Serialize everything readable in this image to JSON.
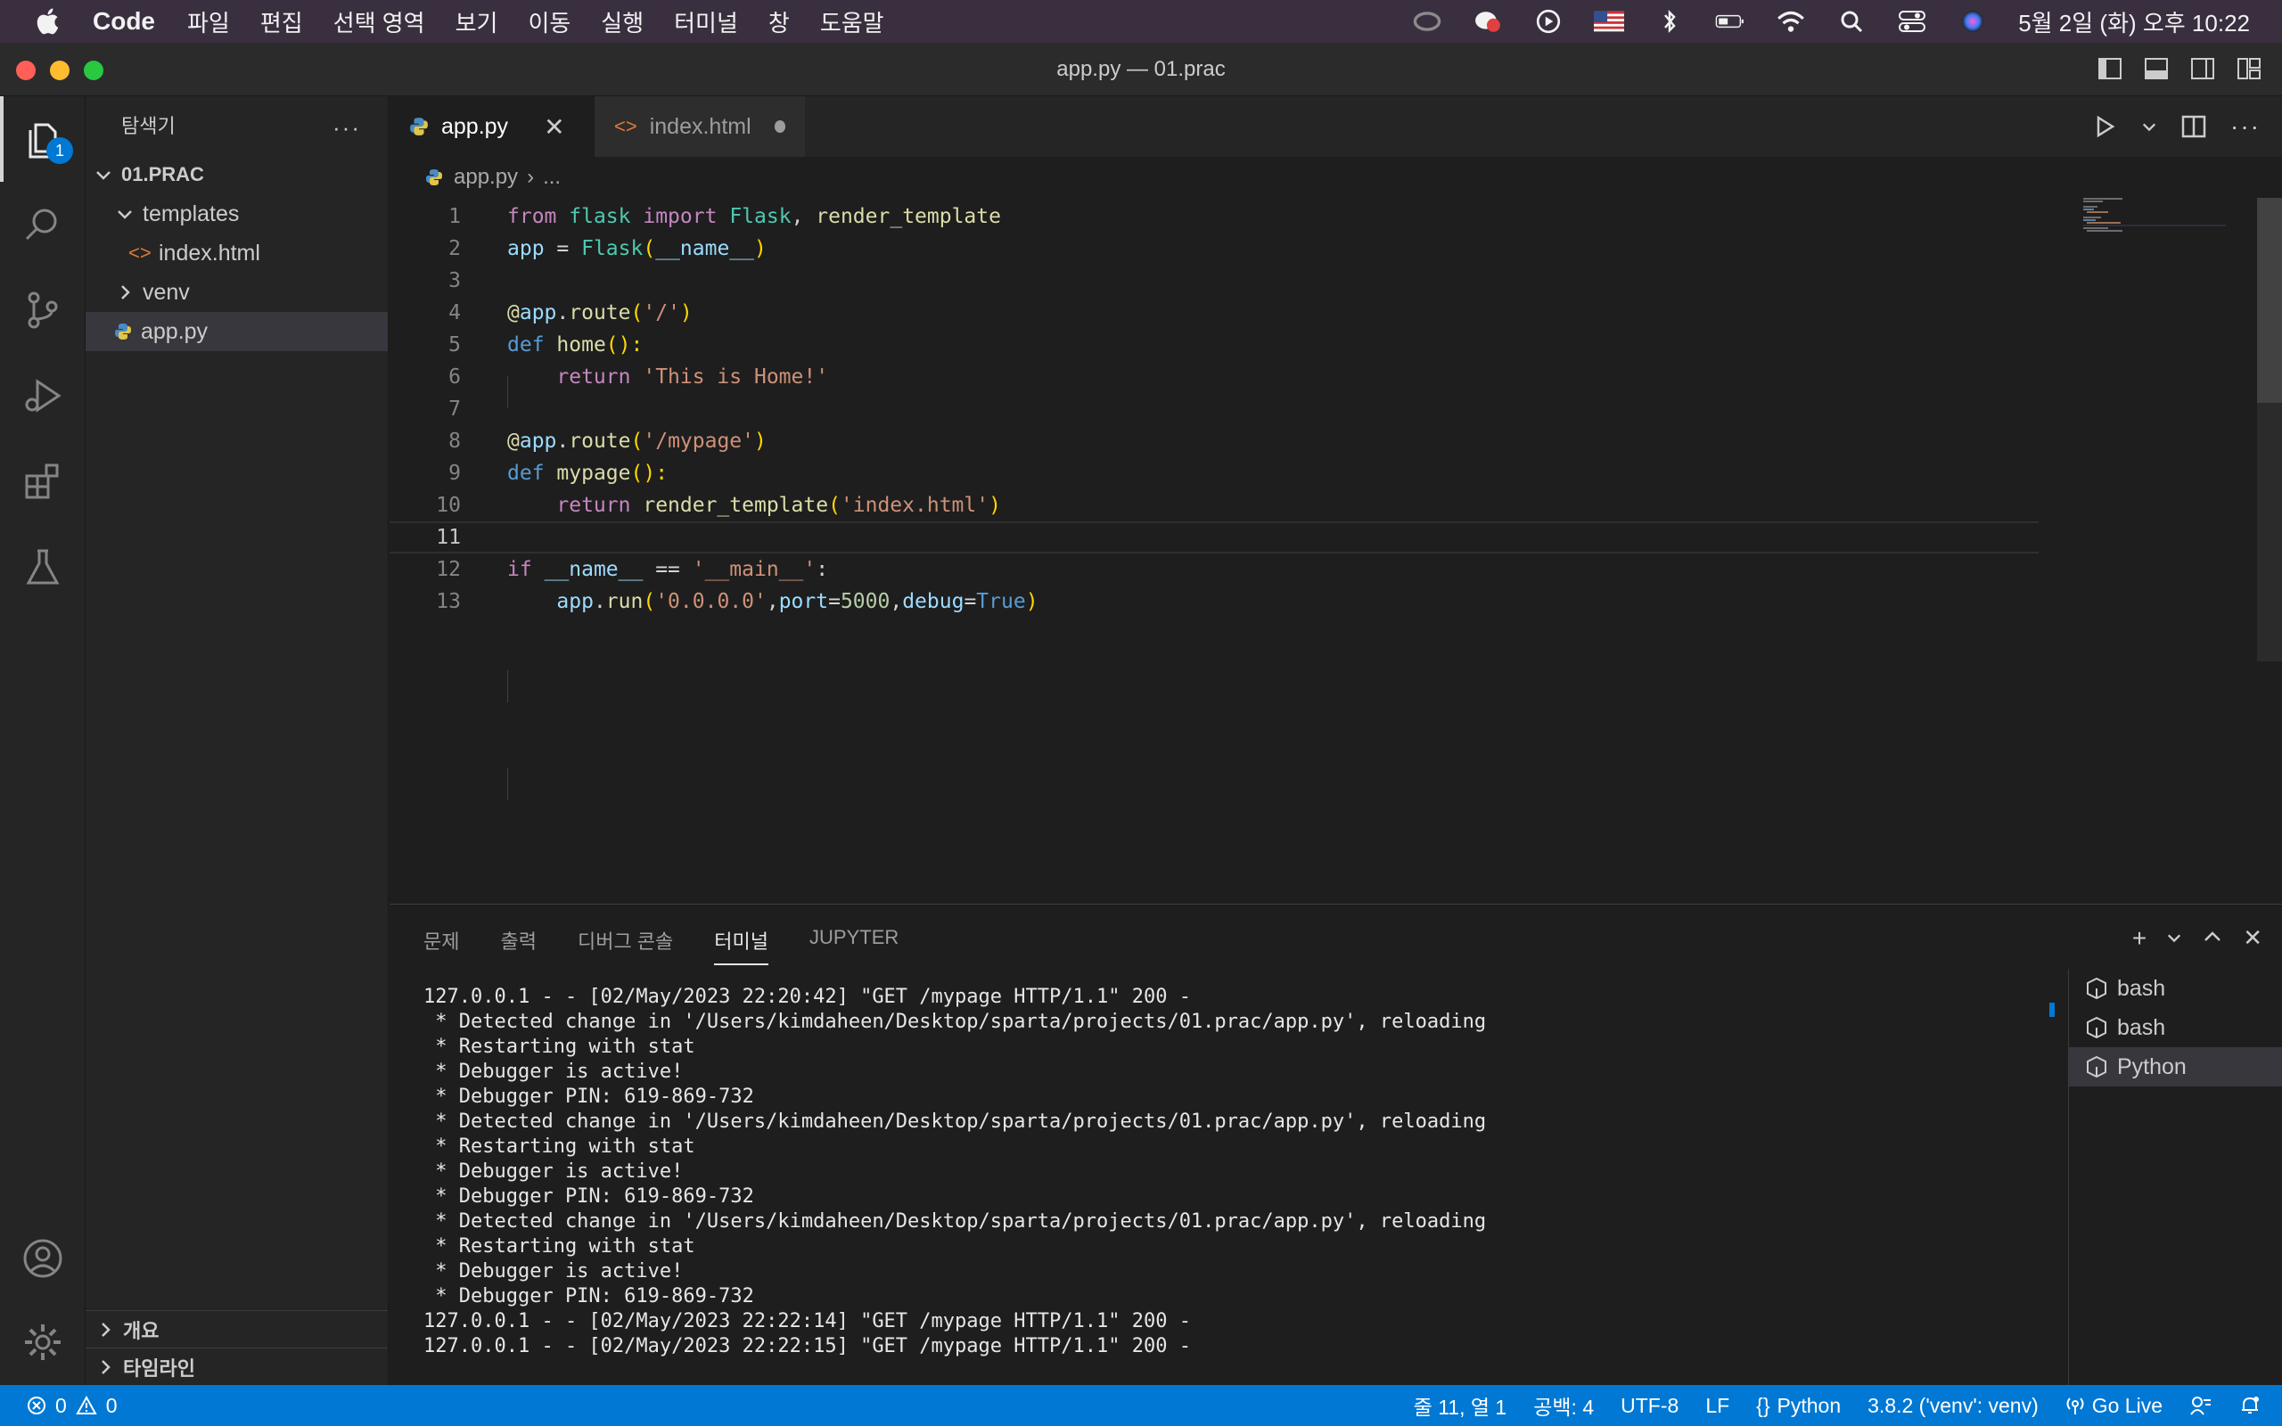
{
  "menubar": {
    "app_name": "Code",
    "items": [
      "파일",
      "편집",
      "선택 영역",
      "보기",
      "이동",
      "실행",
      "터미널",
      "창",
      "도움말"
    ],
    "clock": "5월 2일 (화) 오후 10:22"
  },
  "window": {
    "title": "app.py — 01.prac"
  },
  "activity": {
    "explorer_badge": "1"
  },
  "sidebar": {
    "title": "탐색기",
    "more": "···",
    "root": "01.PRAC",
    "items": [
      {
        "label": "templates"
      },
      {
        "label": "index.html"
      },
      {
        "label": "venv"
      },
      {
        "label": "app.py"
      }
    ],
    "outline": "개요",
    "timeline": "타임라인"
  },
  "tabs": [
    {
      "label": "app.py"
    },
    {
      "label": "index.html"
    }
  ],
  "breadcrumb": {
    "file": "app.py",
    "rest": "..."
  },
  "editor": {
    "line_numbers": [
      "1",
      "2",
      "3",
      "4",
      "5",
      "6",
      "7",
      "8",
      "9",
      "10",
      "11",
      "12",
      "13"
    ],
    "lines": [
      "from flask import Flask, render_template",
      "app = Flask(__name__)",
      "",
      "@app.route('/')",
      "def home():",
      "    return 'This is Home!'",
      "",
      "@app.route('/mypage')",
      "def mypage():",
      "    return render_template('index.html')",
      "",
      "if __name__ == '__main__':",
      "    app.run('0.0.0.0',port=5000,debug=True)"
    ]
  },
  "panel": {
    "tabs": [
      "문제",
      "출력",
      "디버그 콘솔",
      "터미널",
      "JUPYTER"
    ],
    "terminal_lines": [
      "127.0.0.1 - - [02/May/2023 22:20:42] \"GET /mypage HTTP/1.1\" 200 -",
      " * Detected change in '/Users/kimdaheen/Desktop/sparta/projects/01.prac/app.py', reloading",
      " * Restarting with stat",
      " * Debugger is active!",
      " * Debugger PIN: 619-869-732",
      " * Detected change in '/Users/kimdaheen/Desktop/sparta/projects/01.prac/app.py', reloading",
      " * Restarting with stat",
      " * Debugger is active!",
      " * Debugger PIN: 619-869-732",
      " * Detected change in '/Users/kimdaheen/Desktop/sparta/projects/01.prac/app.py', reloading",
      " * Restarting with stat",
      " * Debugger is active!",
      " * Debugger PIN: 619-869-732",
      "127.0.0.1 - - [02/May/2023 22:22:14] \"GET /mypage HTTP/1.1\" 200 -",
      "127.0.0.1 - - [02/May/2023 22:22:15] \"GET /mypage HTTP/1.1\" 200 -"
    ],
    "terminals": [
      "bash",
      "bash",
      "Python"
    ]
  },
  "statusbar": {
    "errors": "0",
    "warnings": "0",
    "position": "줄 11, 열 1",
    "spaces": "공백: 4",
    "encoding": "UTF-8",
    "eol": "LF",
    "language": "Python",
    "interpreter": "3.8.2 ('venv': venv)",
    "golive": "Go Live"
  },
  "colors": {
    "accent": "#0078d4",
    "menubar": "#3a2f3f",
    "editor_bg": "#1e1e1e"
  }
}
